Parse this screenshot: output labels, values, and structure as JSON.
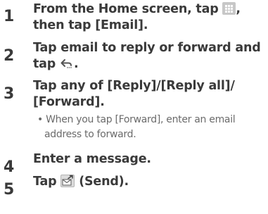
{
  "steps": [
    {
      "number": "1",
      "line1_a": "From the Home screen, tap ",
      "line1_b": ",",
      "line2": "then tap [Email].",
      "icon": "apps-grid-icon"
    },
    {
      "number": "2",
      "line1": "Tap email to reply or forward and",
      "line2_a": "tap ",
      "line2_b": ".",
      "icon": "reply-arrow-icon"
    },
    {
      "number": "3",
      "line1": "Tap any of [Reply]/[Reply all]/",
      "line2": "[Forward].",
      "note_bullet": "•",
      "note_line1": "When you tap [Forward], enter an email",
      "note_line2": "address to forward."
    },
    {
      "number": "4",
      "line1": "Enter a message."
    },
    {
      "number": "5",
      "line1_a": "Tap ",
      "line1_b": " (Send).",
      "icon": "send-mail-icon"
    }
  ]
}
